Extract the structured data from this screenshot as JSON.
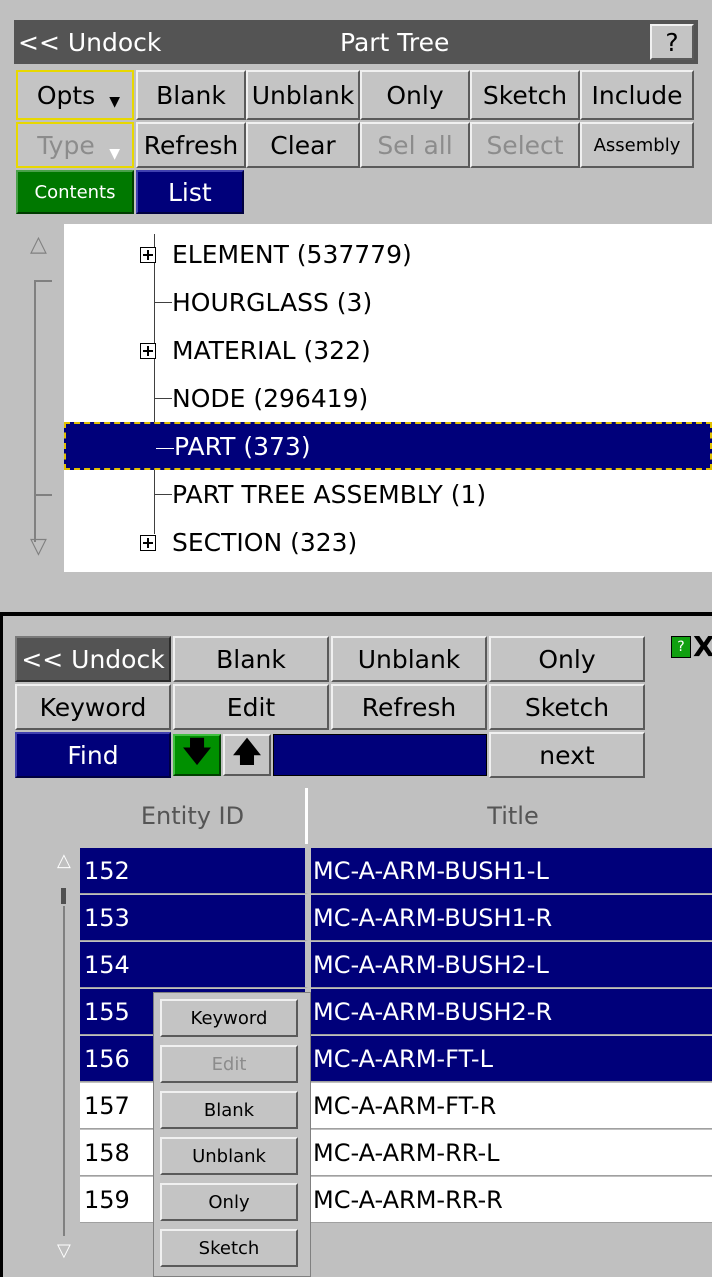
{
  "part_tree": {
    "undock_label": "<< Undock",
    "title": "Part Tree",
    "help_label": "?",
    "toolbar_row1": [
      "Opts",
      "Blank",
      "Unblank",
      "Only",
      "Sketch",
      "Include"
    ],
    "toolbar_row2": [
      "Type",
      "Refresh",
      "Clear",
      "Sel all",
      "Select",
      "Assembly"
    ],
    "tabs": {
      "contents": "Contents",
      "list": "List"
    },
    "items": [
      {
        "label": "ELEMENT (537779)",
        "expandable": true,
        "selected": false
      },
      {
        "label": "HOURGLASS (3)",
        "expandable": false,
        "selected": false
      },
      {
        "label": "MATERIAL (322)",
        "expandable": true,
        "selected": false
      },
      {
        "label": "NODE (296419)",
        "expandable": false,
        "selected": false
      },
      {
        "label": "PART (373)",
        "expandable": false,
        "selected": true
      },
      {
        "label": "PART TREE ASSEMBLY (1)",
        "expandable": false,
        "selected": false
      },
      {
        "label": "SECTION (323)",
        "expandable": true,
        "selected": false
      }
    ]
  },
  "entity_list": {
    "undock_label": "<< Undock",
    "row1": [
      "Blank",
      "Unblank",
      "Only"
    ],
    "row2": [
      "Keyword",
      "Edit",
      "Refresh",
      "Sketch"
    ],
    "find_label": "Find",
    "find_value": "",
    "next_label": "next",
    "help_label": "?",
    "close_label": "X",
    "columns": [
      "Entity ID",
      "Title"
    ],
    "rows": [
      {
        "id": "152",
        "title": "MC-A-ARM-BUSH1-L",
        "selected": true
      },
      {
        "id": "153",
        "title": "MC-A-ARM-BUSH1-R",
        "selected": true
      },
      {
        "id": "154",
        "title": "MC-A-ARM-BUSH2-L",
        "selected": true
      },
      {
        "id": "155",
        "title": "MC-A-ARM-BUSH2-R",
        "selected": true
      },
      {
        "id": "156",
        "title": "MC-A-ARM-FT-L",
        "selected": true
      },
      {
        "id": "157",
        "title": "MC-A-ARM-FT-R",
        "selected": false
      },
      {
        "id": "158",
        "title": "MC-A-ARM-RR-L",
        "selected": false
      },
      {
        "id": "159",
        "title": "MC-A-ARM-RR-R",
        "selected": false
      }
    ],
    "context_menu": [
      "Keyword",
      "Edit",
      "Blank",
      "Unblank",
      "Only",
      "Sketch"
    ]
  },
  "colors": {
    "panel_bg": "#c0c0c0",
    "selection": "#00007a",
    "contents_tab": "#007800",
    "highlight_border": "#e8d800"
  }
}
